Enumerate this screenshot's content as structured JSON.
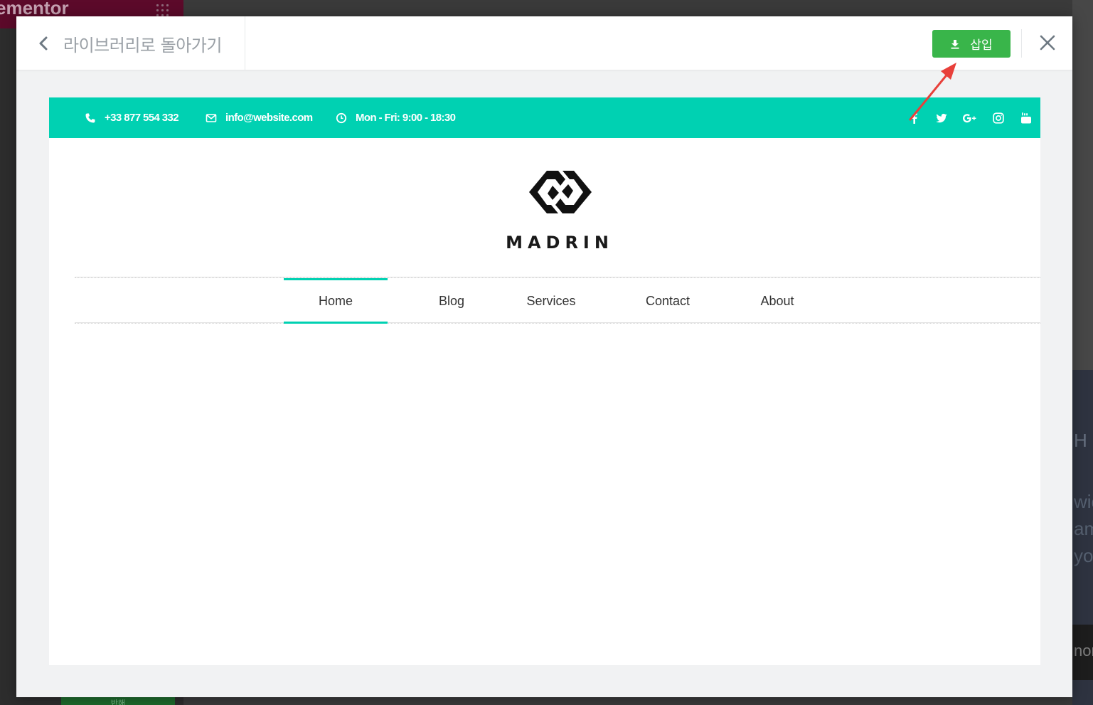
{
  "background": {
    "brand_text": "ementor",
    "right_fragments": [
      "H",
      "wic",
      "am",
      "yo",
      "nor"
    ],
    "bottom_button_label": "반해"
  },
  "modal": {
    "back_label": "라이브러리로 돌아가기",
    "insert_label": "삽입",
    "colors": {
      "insert": "#39b54a",
      "modal_bg": "#f1f2f3"
    }
  },
  "preview": {
    "accent_color": "#00d1b2",
    "topbar": {
      "phone": "+33 877 554 332",
      "email": "info@website.com",
      "hours": "Mon - Fri: 9:00 - 18:30",
      "social_icons": [
        "facebook-icon",
        "twitter-icon",
        "google-plus-icon",
        "instagram-icon",
        "youtube-icon"
      ]
    },
    "brand_name": "MADRIN",
    "nav": {
      "items": [
        {
          "label": "Home",
          "active": true
        },
        {
          "label": "Blog"
        },
        {
          "label": "Services"
        },
        {
          "label": "Contact"
        },
        {
          "label": "About"
        }
      ]
    }
  },
  "annotation": {
    "color": "#e8403a"
  }
}
